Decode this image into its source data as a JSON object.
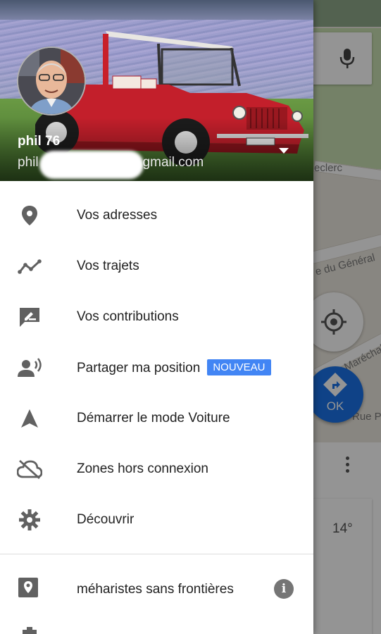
{
  "account": {
    "name": "phil 76",
    "email_prefix": "phil",
    "email_suffix": "gmail.com"
  },
  "menu": {
    "items": [
      {
        "label": "Vos adresses",
        "icon": "place-pin-icon"
      },
      {
        "label": "Vos trajets",
        "icon": "timeline-icon"
      },
      {
        "label": "Vos contributions",
        "icon": "contributions-icon"
      },
      {
        "label": "Partager ma position",
        "icon": "share-location-icon",
        "badge": "NOUVEAU"
      },
      {
        "label": "Démarrer le mode Voiture",
        "icon": "navigation-arrow-icon"
      },
      {
        "label": "Zones hors connexion",
        "icon": "offline-cloud-icon"
      },
      {
        "label": "Découvrir",
        "icon": "explore-gear-icon"
      }
    ],
    "group": {
      "label": "méharistes sans frontières",
      "icon": "map-pin-square-icon",
      "info": "i"
    }
  },
  "map": {
    "streets": [
      "eclerc",
      "e du Général",
      "Maréchal",
      "Rue P"
    ],
    "go_label": "OK",
    "temperature": "14°"
  },
  "colors": {
    "accent": "#4285f4",
    "go_button": "#1a73e8",
    "icon_gray": "#616161",
    "text": "#222222"
  }
}
